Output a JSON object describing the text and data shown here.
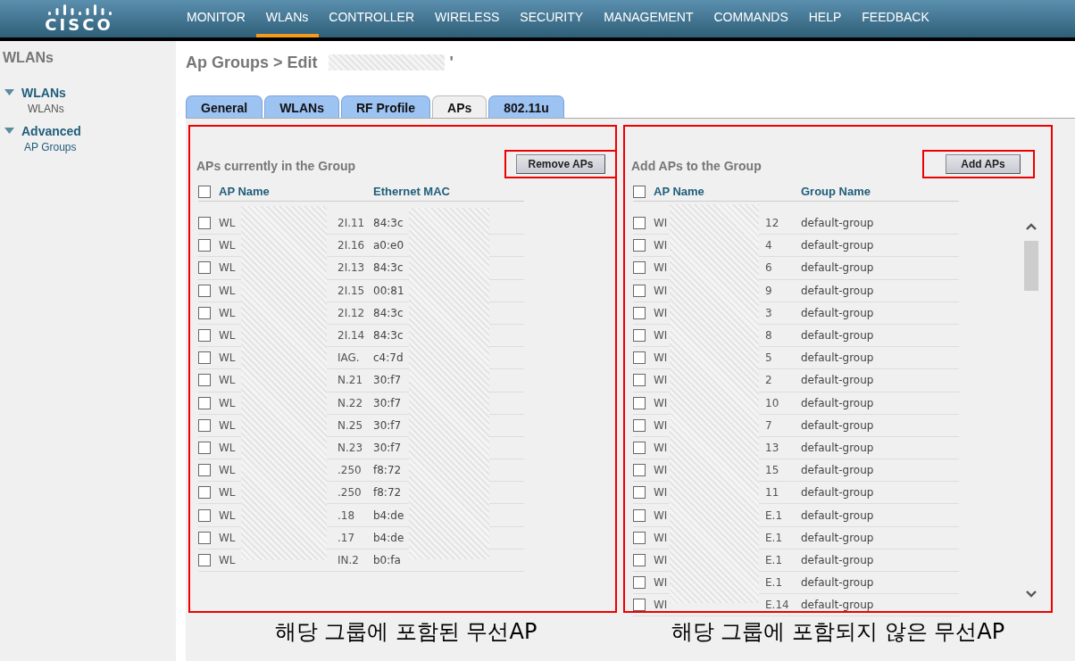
{
  "brand": {
    "logo": "CISCO"
  },
  "nav": [
    {
      "label": "MONITOR",
      "selected": false
    },
    {
      "label": "WLANs",
      "selected": true
    },
    {
      "label": "CONTROLLER",
      "selected": false
    },
    {
      "label": "WIRELESS",
      "selected": false
    },
    {
      "label": "SECURITY",
      "selected": false
    },
    {
      "label": "MANAGEMENT",
      "selected": false
    },
    {
      "label": "COMMANDS",
      "selected": false
    },
    {
      "label": "HELP",
      "selected": false
    },
    {
      "label": "FEEDBACK",
      "selected": false
    }
  ],
  "sidebar": {
    "title": "WLANs",
    "sections": [
      {
        "label": "WLANs",
        "expanded": true,
        "children": [
          {
            "label": "WLANs",
            "kind": "plain"
          }
        ]
      },
      {
        "label": "Advanced",
        "expanded": true,
        "children": [
          {
            "label": "AP Groups",
            "kind": "link"
          }
        ]
      }
    ]
  },
  "page": {
    "title": "Ap Groups > Edit",
    "title_suffix": "'"
  },
  "tabs": [
    {
      "label": "General",
      "selected": false
    },
    {
      "label": "WLANs",
      "selected": false
    },
    {
      "label": "RF Profile",
      "selected": false
    },
    {
      "label": "APs",
      "selected": true
    },
    {
      "label": "802.11u",
      "selected": false
    }
  ],
  "in_group": {
    "title": "APs currently in the Group",
    "button": "Remove APs",
    "columns": [
      "AP Name",
      "Ethernet MAC"
    ],
    "all_checked": false,
    "caption": "해당 그룹에 포함된 무선AP",
    "rows": [
      {
        "checked": false,
        "name_start": "WL",
        "name_end": "2I.11",
        "mac": "84:3c"
      },
      {
        "checked": false,
        "name_start": "WL",
        "name_end": "2I.16",
        "mac": "a0:e0"
      },
      {
        "checked": false,
        "name_start": "WL",
        "name_end": "2I.13",
        "mac": "84:3c"
      },
      {
        "checked": false,
        "name_start": "WL",
        "name_end": "2I.15",
        "mac": "00:81"
      },
      {
        "checked": false,
        "name_start": "WL",
        "name_end": "2I.12",
        "mac": "84:3c"
      },
      {
        "checked": false,
        "name_start": "WL",
        "name_end": "2I.14",
        "mac": "84:3c"
      },
      {
        "checked": false,
        "name_start": "WL",
        "name_end": "IAG.",
        "mac": "c4:7d"
      },
      {
        "checked": false,
        "name_start": "WL",
        "name_end": "N.21",
        "mac": "30:f7"
      },
      {
        "checked": false,
        "name_start": "WL",
        "name_end": "N.22",
        "mac": "30:f7"
      },
      {
        "checked": false,
        "name_start": "WL",
        "name_end": "N.25",
        "mac": "30:f7"
      },
      {
        "checked": false,
        "name_start": "WL",
        "name_end": "N.23",
        "mac": "30:f7"
      },
      {
        "checked": false,
        "name_start": "WL",
        "name_end": ".250",
        "mac": "f8:72"
      },
      {
        "checked": false,
        "name_start": "WL",
        "name_end": ".250",
        "mac": "f8:72"
      },
      {
        "checked": false,
        "name_start": "WL",
        "name_end": ".18",
        "mac": "b4:de"
      },
      {
        "checked": false,
        "name_start": "WL",
        "name_end": ".17",
        "mac": "b4:de"
      },
      {
        "checked": false,
        "name_start": "WL",
        "name_end": "IN.2",
        "mac": "b0:fa"
      }
    ]
  },
  "add": {
    "title": "Add APs to the Group",
    "button": "Add APs",
    "columns": [
      "AP Name",
      "Group Name"
    ],
    "all_checked": false,
    "caption": "해당 그룹에 포함되지 않은 무선AP",
    "rows": [
      {
        "checked": false,
        "name_start": "WI",
        "name_end": "12",
        "group": "default-group"
      },
      {
        "checked": false,
        "name_start": "WI",
        "name_end": "4",
        "group": "default-group"
      },
      {
        "checked": false,
        "name_start": "WI",
        "name_end": "6",
        "group": "default-group"
      },
      {
        "checked": false,
        "name_start": "WI",
        "name_end": "9",
        "group": "default-group"
      },
      {
        "checked": false,
        "name_start": "WI",
        "name_end": "3",
        "group": "default-group"
      },
      {
        "checked": false,
        "name_start": "WI",
        "name_end": "8",
        "group": "default-group"
      },
      {
        "checked": false,
        "name_start": "WI",
        "name_end": "5",
        "group": "default-group"
      },
      {
        "checked": false,
        "name_start": "WI",
        "name_end": "2",
        "group": "default-group"
      },
      {
        "checked": false,
        "name_start": "WI",
        "name_end": "10",
        "group": "default-group"
      },
      {
        "checked": false,
        "name_start": "WI",
        "name_end": "7",
        "group": "default-group"
      },
      {
        "checked": false,
        "name_start": "WI",
        "name_end": "13",
        "group": "default-group"
      },
      {
        "checked": false,
        "name_start": "WI",
        "name_end": "15",
        "group": "default-group"
      },
      {
        "checked": false,
        "name_start": "WI",
        "name_end": "11",
        "group": "default-group"
      },
      {
        "checked": false,
        "name_start": "WI",
        "name_end": "E.1",
        "group": "default-group"
      },
      {
        "checked": false,
        "name_start": "WI",
        "name_end": "E.1",
        "group": "default-group"
      },
      {
        "checked": false,
        "name_start": "WI",
        "name_end": "E.1",
        "group": "default-group"
      },
      {
        "checked": false,
        "name_start": "WI",
        "name_end": "E.1",
        "group": "default-group"
      },
      {
        "checked": false,
        "name_start": "WI",
        "name_end": "E.14",
        "group": "default-group"
      }
    ]
  }
}
